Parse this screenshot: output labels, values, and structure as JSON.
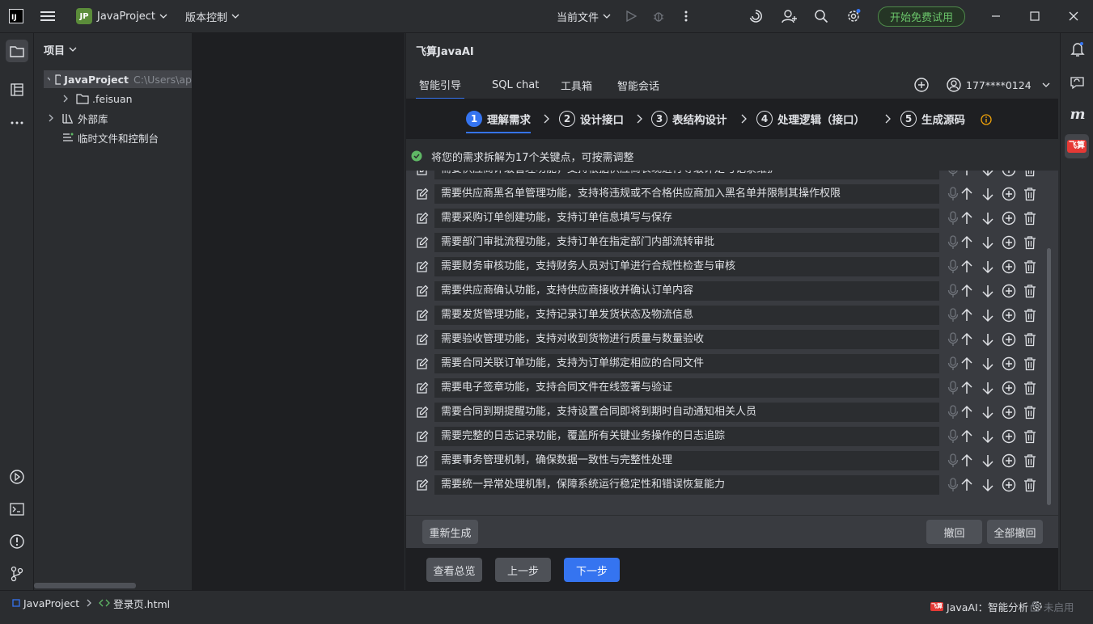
{
  "titlebar": {
    "logo_text": "IJ",
    "project_badge": "JP",
    "project_name": "JavaProject",
    "vcs_label": "版本控制",
    "run_config": "当前文件",
    "trial_label": "开始免费试用"
  },
  "project_panel": {
    "title": "项目",
    "root_name": "JavaProject",
    "root_path": "C:\\Users\\ap",
    "child_folder": ".feisuan",
    "external_libs": "外部库",
    "scratches": "临时文件和控制台"
  },
  "ai_panel": {
    "title": "飞算JavaAI",
    "tabs": [
      "智能引导",
      "SQL chat",
      "工具箱",
      "智能会话"
    ],
    "account": "177****0124",
    "steps": [
      {
        "num": "1",
        "label": "理解需求"
      },
      {
        "num": "2",
        "label": "设计接口"
      },
      {
        "num": "3",
        "label": "表结构设计"
      },
      {
        "num": "4",
        "label": "处理逻辑（接口）"
      },
      {
        "num": "5",
        "label": "生成源码"
      }
    ],
    "status_message": "将您的需求拆解为17个关键点，可按需调整",
    "requirements": [
      "需要供应商评级管理功能，支持根据供应商表现进行等级评定与记录维护",
      "需要供应商黑名单管理功能，支持将违规或不合格供应商加入黑名单并限制其操作权限",
      "需要采购订单创建功能，支持订单信息填写与保存",
      "需要部门审批流程功能，支持订单在指定部门内部流转审批",
      "需要财务审核功能，支持财务人员对订单进行合规性检查与审核",
      "需要供应商确认功能，支持供应商接收并确认订单内容",
      "需要发货管理功能，支持记录订单发货状态及物流信息",
      "需要验收管理功能，支持对收到货物进行质量与数量验收",
      "需要合同关联订单功能，支持为订单绑定相应的合同文件",
      "需要电子签章功能，支持合同文件在线签署与验证",
      "需要合同到期提醒功能，支持设置合同即将到期时自动通知相关人员",
      "需要完整的日志记录功能，覆盖所有关键业务操作的日志追踪",
      "需要事务管理机制，确保数据一致性与完整性处理",
      "需要统一异常处理机制，保障系统运行稳定性和错误恢复能力"
    ],
    "regenerate": "重新生成",
    "undo": "撤回",
    "undo_all": "全部撤回",
    "overview": "查看总览",
    "prev": "上一步",
    "next": "下一步"
  },
  "right_strip": {
    "m_icon": "m",
    "feisuan_badge": "飞算"
  },
  "statusbar": {
    "project": "JavaProject",
    "file": "登录页.html",
    "plugin_label": "JavaAI：智能分析",
    "disabled_label": "未启用"
  },
  "colors": {
    "accent": "#3574f0",
    "success": "#5fb865",
    "warning": "#f0a30a",
    "brand_red": "#e53935"
  }
}
